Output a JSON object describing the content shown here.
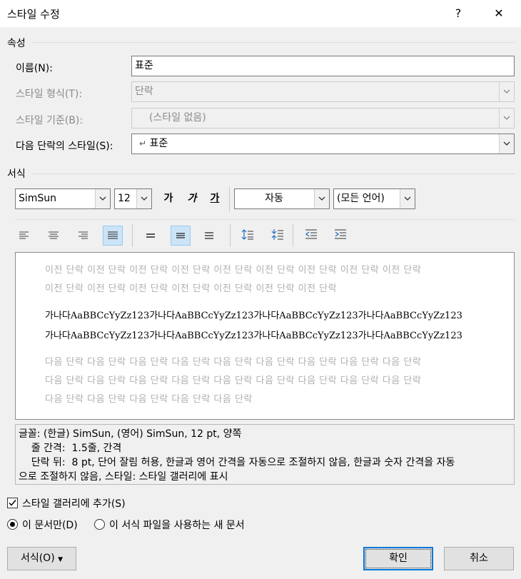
{
  "window": {
    "title": "스타일 수정",
    "help": "?",
    "close": "✕"
  },
  "properties": {
    "section": "속성",
    "name": {
      "label": "이름(N):",
      "value": "표준"
    },
    "style_type": {
      "label": "스타일 형식(T):",
      "value": "단락"
    },
    "based_on": {
      "label": "스타일 기준(B):",
      "value": "(스타일 없음)"
    },
    "next_style": {
      "label": "다음 단락의 스타일(S):",
      "value": "표준",
      "prefix": "↵"
    }
  },
  "formatting": {
    "section": "서식",
    "font": "SimSun",
    "size": "12",
    "bold": "가",
    "italic": "가",
    "underline": "가",
    "color": "자동",
    "language": "(모든 언어)"
  },
  "preview": {
    "prev_lines": [
      "이전 단락 이전 단락 이전 단락 이전 단락 이전 단락 이전 단락 이전 단락 이전 단락 이전 단락",
      "이전 단락 이전 단락 이전 단락 이전 단락 이전 단락 이전 단락 이전 단락"
    ],
    "sample_lines": [
      "가나다AaBBCcYyZz123가나다AaBBCcYyZz123가나다AaBBCcYyZz123가나다AaBBCcYyZz123",
      "가나다AaBBCcYyZz123가나다AaBBCcYyZz123가나다AaBBCcYyZz123가나다AaBBCcYyZz123"
    ],
    "next_lines": [
      "다음 단락 다음 단락 다음 단락 다음 단락 다음 단락 다음 단락 다음 단락 다음 단락 다음 단락",
      "다음 단락 다음 단락 다음 단락 다음 단락 다음 단락 다음 단락 다음 단락 다음 단락 다음 단락",
      "다음 단락 다음 단락 다음 단락 다음 단락 다음 단락"
    ]
  },
  "description": [
    "글꼴: (한글) SimSun, (영어) SimSun, 12 pt, 양쪽",
    "    줄 간격:  1.5줄, 간격",
    "    단락 뒤:  8 pt, 단어 잘림 허용, 한글과 영어 간격을 자동으로 조절하지 않음, 한글과 숫자 간격을 자동",
    "으로 조절하지 않음, 스타일: 스타일 갤러리에 표시"
  ],
  "options": {
    "add_to_gallery": {
      "label": "스타일 갤러리에 추가(S)",
      "checked": true
    },
    "only_this_doc": {
      "label": "이 문서만(D)",
      "selected": true
    },
    "new_docs": {
      "label": "이 서식 파일을 사용하는 새 문서",
      "selected": false
    }
  },
  "buttons": {
    "format": "서식(O)",
    "ok": "확인",
    "cancel": "취소"
  },
  "colors": {
    "accent": "#0078d7",
    "active_fill": "#cce4f7",
    "preview_gray": "#b0b0b0"
  }
}
